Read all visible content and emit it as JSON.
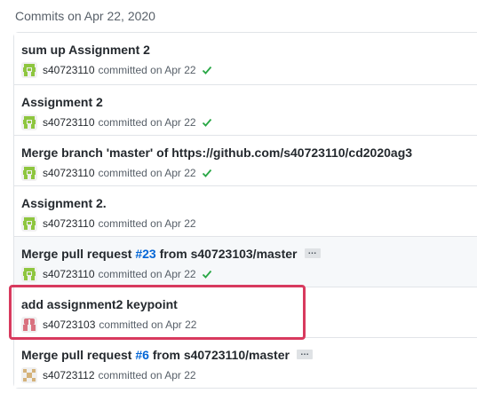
{
  "group": {
    "title": "Commits on Apr 22, 2020"
  },
  "commits": [
    {
      "message": "sum up Assignment 2",
      "author": "s40723110",
      "meta": "committed on Apr 22",
      "avatar": "avatar-green-identicon",
      "status": "check-icon"
    },
    {
      "message": "Assignment 2",
      "author": "s40723110",
      "meta": "committed on Apr 22",
      "avatar": "avatar-green-identicon",
      "status": "check-icon"
    },
    {
      "message": "Merge branch 'master' of https://github.com/s40723110/cd2020ag3",
      "author": "s40723110",
      "meta": "committed on Apr 22",
      "avatar": "avatar-green-identicon",
      "status": "check-icon"
    },
    {
      "message": "Assignment 2.",
      "author": "s40723110",
      "meta": "committed on Apr 22",
      "avatar": "avatar-green-identicon"
    },
    {
      "message_prefix": "Merge pull request ",
      "pr_link": "#23",
      "message_suffix": " from s40723103/master",
      "ellipsis": "…",
      "author": "s40723110",
      "meta": "committed on Apr 22",
      "avatar": "avatar-green-identicon",
      "status": "check-icon"
    },
    {
      "message": "add assignment2 keypoint",
      "author": "s40723103",
      "meta": "committed on Apr 22",
      "avatar": "avatar-red-identicon"
    },
    {
      "message_prefix": "Merge pull request ",
      "pr_link": "#6",
      "message_suffix": " from s40723110/master",
      "ellipsis": "…",
      "author": "s40723112",
      "meta": "committed on Apr 22",
      "avatar": "avatar-tan-identicon"
    }
  ],
  "colors": {
    "link": "#0366d6",
    "success": "#28a745",
    "highlight": "#d83a5e",
    "avatar_green": "#8ec63f",
    "avatar_red": "#d9727f",
    "avatar_tan": "#d4b27a"
  }
}
